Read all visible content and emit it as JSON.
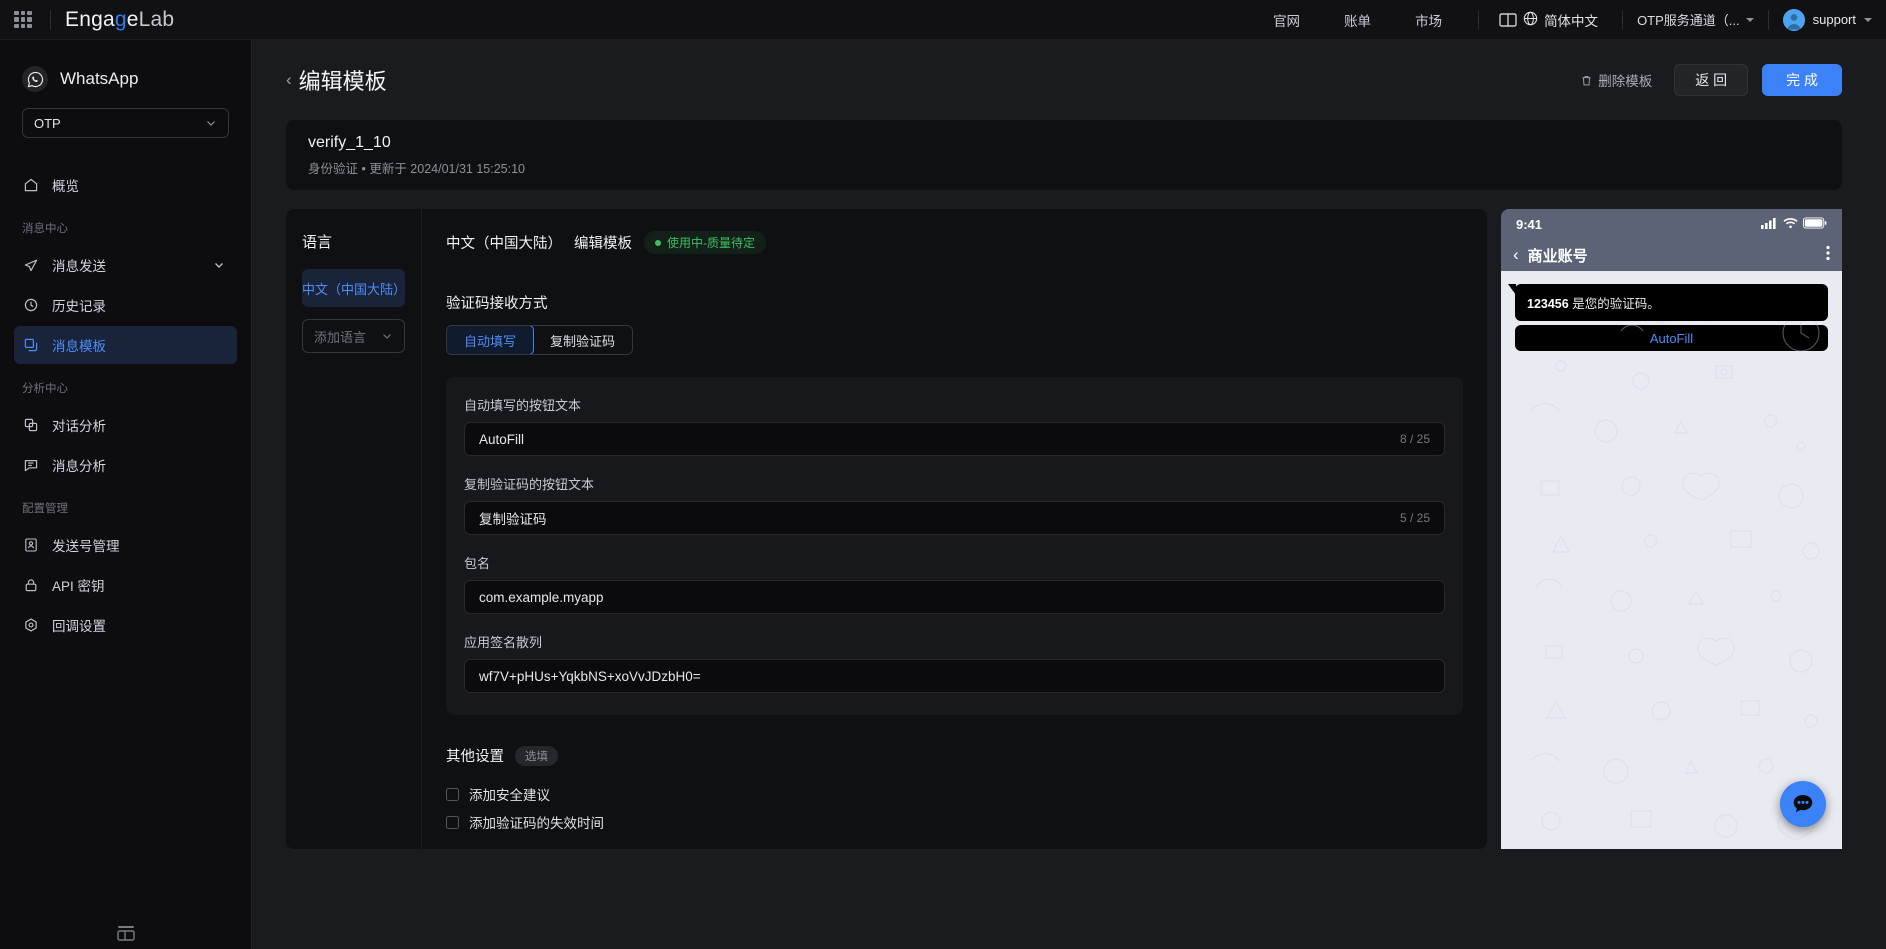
{
  "topbar": {
    "apps_icon": "grid-apps-icon",
    "logo": {
      "prefix": "Enga",
      "o": "g",
      "suffix": "e",
      "lab": "Lab"
    },
    "links": [
      {
        "label": "官网",
        "name": "topbar-link-official-site"
      },
      {
        "label": "账单",
        "name": "topbar-link-billing"
      },
      {
        "label": "市场",
        "name": "topbar-link-market"
      }
    ],
    "docs_icon": "book-panel-icon",
    "language": {
      "icon": "globe-icon",
      "label": "简体中文"
    },
    "channel": {
      "label": "OTP服务通道（...",
      "icon": "chevron-down-icon"
    },
    "user": {
      "name": "support",
      "avatar": "user-avatar",
      "icon": "chevron-down-icon"
    }
  },
  "sidebar": {
    "brand": {
      "name": "WhatsApp",
      "icon": "whatsapp-icon"
    },
    "channel_select": {
      "value": "OTP",
      "icon": "chevron-down-icon"
    },
    "items": [
      {
        "label": "概览",
        "icon": "home-icon",
        "name": "sidebar-item-overview",
        "active": false,
        "group": null
      },
      {
        "label": "消息发送",
        "icon": "send-icon",
        "name": "sidebar-item-message-send",
        "active": false,
        "expandable": true
      },
      {
        "label": "历史记录",
        "icon": "history-icon",
        "name": "sidebar-item-history",
        "active": false
      },
      {
        "label": "消息模板",
        "icon": "template-icon",
        "name": "sidebar-item-message-template",
        "active": true
      },
      {
        "label": "对话分析",
        "icon": "conversation-analytics-icon",
        "name": "sidebar-item-conversation-analytics",
        "active": false
      },
      {
        "label": "消息分析",
        "icon": "message-analytics-icon",
        "name": "sidebar-item-message-analytics",
        "active": false
      },
      {
        "label": "发送号管理",
        "icon": "phone-number-icon",
        "name": "sidebar-item-sender-management",
        "active": false
      },
      {
        "label": "API 密钥",
        "icon": "lock-icon",
        "name": "sidebar-item-api-key",
        "active": false
      },
      {
        "label": "回调设置",
        "icon": "callback-icon",
        "name": "sidebar-item-callback-settings",
        "active": false
      }
    ],
    "groups": {
      "message_center": "消息中心",
      "analytics_center": "分析中心",
      "config_management": "配置管理"
    },
    "collapse_icon": "collapse-sidebar-icon"
  },
  "page": {
    "back_icon": "chevron-left-icon",
    "title": "编辑模板",
    "delete_label": "删除模板",
    "delete_icon": "trash-icon",
    "back_label": "返 回",
    "submit_label": "完 成"
  },
  "template_info": {
    "name": "verify_1_10",
    "meta": "身份验证 • 更新于 2024/01/31 15:25:10"
  },
  "language_pane": {
    "heading": "语言",
    "selected": "中文（中国大陆）",
    "add_placeholder": "添加语言",
    "add_icon": "chevron-down-icon"
  },
  "editor": {
    "header_lang": "中文（中国大陆）",
    "header_action": "编辑模板",
    "status": "使用中-质量待定",
    "status_color": "#3fbf5f",
    "section_heading": "验证码接收方式",
    "segments": [
      {
        "label": "自动填写",
        "selected": true,
        "name": "segment-autofill"
      },
      {
        "label": "复制验证码",
        "selected": false,
        "name": "segment-copy-code"
      }
    ],
    "fields": [
      {
        "label": "自动填写的按钮文本",
        "value": "AutoFill",
        "count": "8 / 25",
        "name": "autofill-button-text-field"
      },
      {
        "label": "复制验证码的按钮文本",
        "value": "复制验证码",
        "count": "5 / 25",
        "name": "copy-code-button-text-field"
      },
      {
        "label": "包名",
        "value": "com.example.myapp",
        "count": "",
        "name": "package-name-field"
      },
      {
        "label": "应用签名散列",
        "value": "wf7V+pHUs+YqkbNS+xoVvJDzbH0=",
        "count": "",
        "name": "app-signature-hash-field"
      }
    ],
    "other": {
      "heading": "其他设置",
      "badge": "选填",
      "checkboxes": [
        {
          "label": "添加安全建议",
          "checked": false,
          "name": "checkbox-add-security-advice"
        },
        {
          "label": "添加验证码的失效时间",
          "checked": false,
          "name": "checkbox-add-code-expiry"
        }
      ]
    }
  },
  "preview": {
    "time": "9:41",
    "signal_icon": "cellular-signal-icon",
    "wifi_icon": "wifi-icon",
    "battery_icon": "battery-icon",
    "back_icon": "chevron-left-icon",
    "contact": "商业账号",
    "menu_icon": "more-vertical-icon",
    "message_code": "123456",
    "message_text": " 是您的验证码。",
    "button_label": "AutoFill"
  },
  "fab": {
    "icon": "chat-bubble-icon",
    "color": "#3b82f6"
  }
}
